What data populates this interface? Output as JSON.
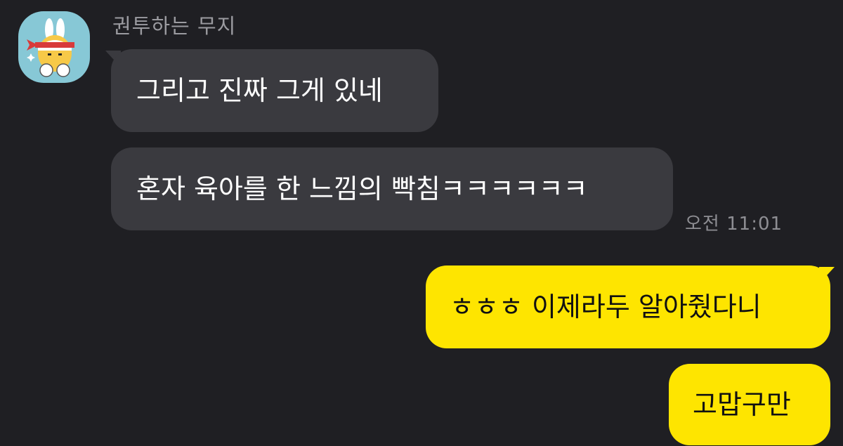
{
  "chat": {
    "sender_name": "권투하는 무지",
    "avatar_icon": "muji-boxer-avatar-icon",
    "messages": [
      {
        "side": "received",
        "text": "그리고 진짜 그게 있네"
      },
      {
        "side": "received",
        "text": "혼자 육아를 한 느낌의 빡침ㅋㅋㅋㅋㅋㅋ"
      },
      {
        "side": "sent",
        "text": "ㅎㅎㅎ 이제라두 알아줬다니"
      },
      {
        "side": "sent",
        "text": "고맙구만"
      }
    ],
    "received_time": "오전 11:01"
  },
  "colors": {
    "background": "#1f1f23",
    "received_bubble": "#3a3a3f",
    "sent_bubble": "#fee500",
    "avatar_bg": "#87c8d6"
  }
}
